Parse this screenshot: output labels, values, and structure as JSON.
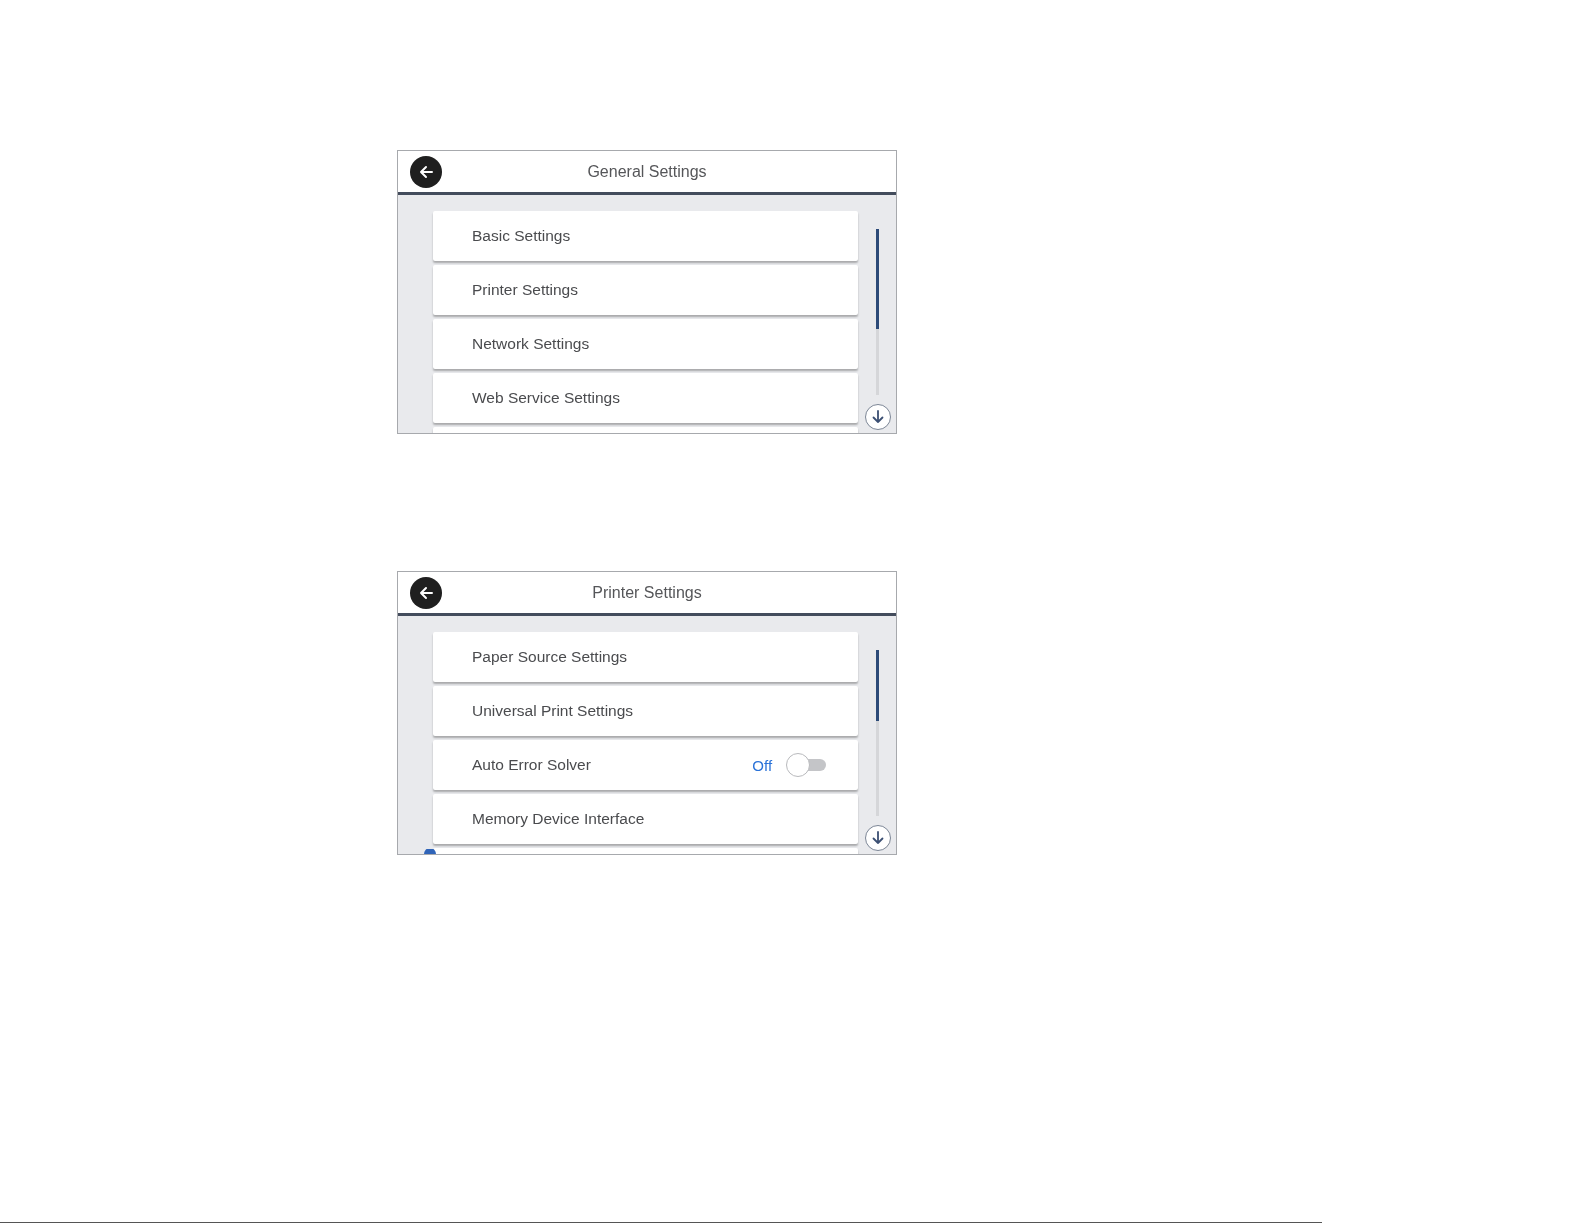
{
  "screens": [
    {
      "title": "General Settings",
      "items": [
        {
          "kind": "link",
          "label": "Basic Settings"
        },
        {
          "kind": "link",
          "label": "Printer Settings"
        },
        {
          "kind": "link",
          "label": "Network Settings"
        },
        {
          "kind": "link",
          "label": "Web Service Settings"
        }
      ],
      "more_below": true
    },
    {
      "title": "Printer Settings",
      "items": [
        {
          "kind": "link",
          "label": "Paper Source Settings"
        },
        {
          "kind": "link",
          "label": "Universal Print Settings"
        },
        {
          "kind": "toggle",
          "label": "Auto Error Solver",
          "value": "Off",
          "on": false
        },
        {
          "kind": "link",
          "label": "Memory Device Interface"
        }
      ],
      "more_below": true,
      "partial_icon": true
    }
  ]
}
